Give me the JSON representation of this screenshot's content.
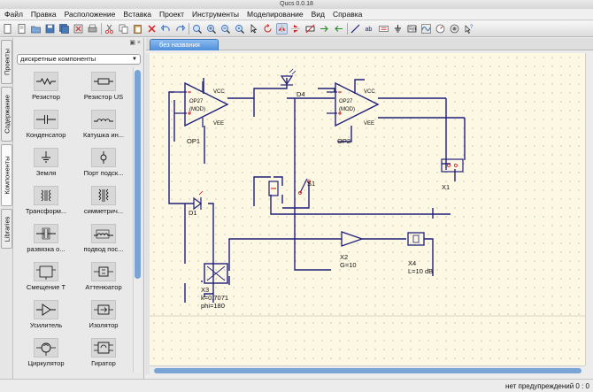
{
  "window": {
    "title": "Qucs 0.0.18"
  },
  "menu": [
    "Файл",
    "Правка",
    "Расположение",
    "Вставка",
    "Проект",
    "Инструменты",
    "Моделирование",
    "Вид",
    "Справка"
  ],
  "side_tabs": [
    "Проекты",
    "Содержание",
    "Компоненты",
    "Libraries"
  ],
  "components_panel": {
    "category": "дискретные компоненты",
    "items": [
      {
        "label": "Резистор",
        "icon": "resistor-icon"
      },
      {
        "label": "Резистор US",
        "icon": "resistor-us-icon"
      },
      {
        "label": "Конденсатор",
        "icon": "capacitor-icon"
      },
      {
        "label": "Катушка ин...",
        "icon": "inductor-icon"
      },
      {
        "label": "Земля",
        "icon": "ground-icon"
      },
      {
        "label": "Порт подск...",
        "icon": "port-icon"
      },
      {
        "label": "Трансформ...",
        "icon": "transformer-icon"
      },
      {
        "label": "симметрич...",
        "icon": "symmetric-transformer-icon"
      },
      {
        "label": "развязка о...",
        "icon": "dc-block-icon"
      },
      {
        "label": "подвод пос...",
        "icon": "dc-feed-icon"
      },
      {
        "label": "Смещение Т",
        "icon": "bias-t-icon"
      },
      {
        "label": "Аттенюатор",
        "icon": "attenuator-icon"
      },
      {
        "label": "Усилитель",
        "icon": "amplifier-icon"
      },
      {
        "label": "Изолятор",
        "icon": "isolator-icon"
      },
      {
        "label": "Циркулятор",
        "icon": "circulator-icon"
      },
      {
        "label": "Гиратор",
        "icon": "gyrator-icon"
      }
    ]
  },
  "document": {
    "tab_title": "без названия"
  },
  "schematic": {
    "op1": {
      "name": "OP1",
      "vcc": "VCC",
      "vee": "VEE",
      "model_1": "OP27",
      "model_2": "(MOD)"
    },
    "op2": {
      "name": "OP2",
      "vcc": "VCC",
      "vee": "VEE",
      "model_1": "OP27",
      "model_2": "(MOD)"
    },
    "d1": "D1",
    "d4": "D4",
    "s1": "S1",
    "x1": "X1",
    "x2": {
      "name": "X2",
      "param": "G=10"
    },
    "x3": {
      "name": "X3",
      "param_k": "k=0.7071",
      "param_phi": "phi=180"
    },
    "x4": {
      "name": "X4",
      "param": "L=10 dB"
    }
  },
  "status": {
    "message": "нет предупреждений  0 : 0"
  },
  "colors": {
    "wire": "#1f1f7a",
    "accent": "#4e8fdc",
    "canvas": "#fcf8e4",
    "pin": "#d01010"
  }
}
